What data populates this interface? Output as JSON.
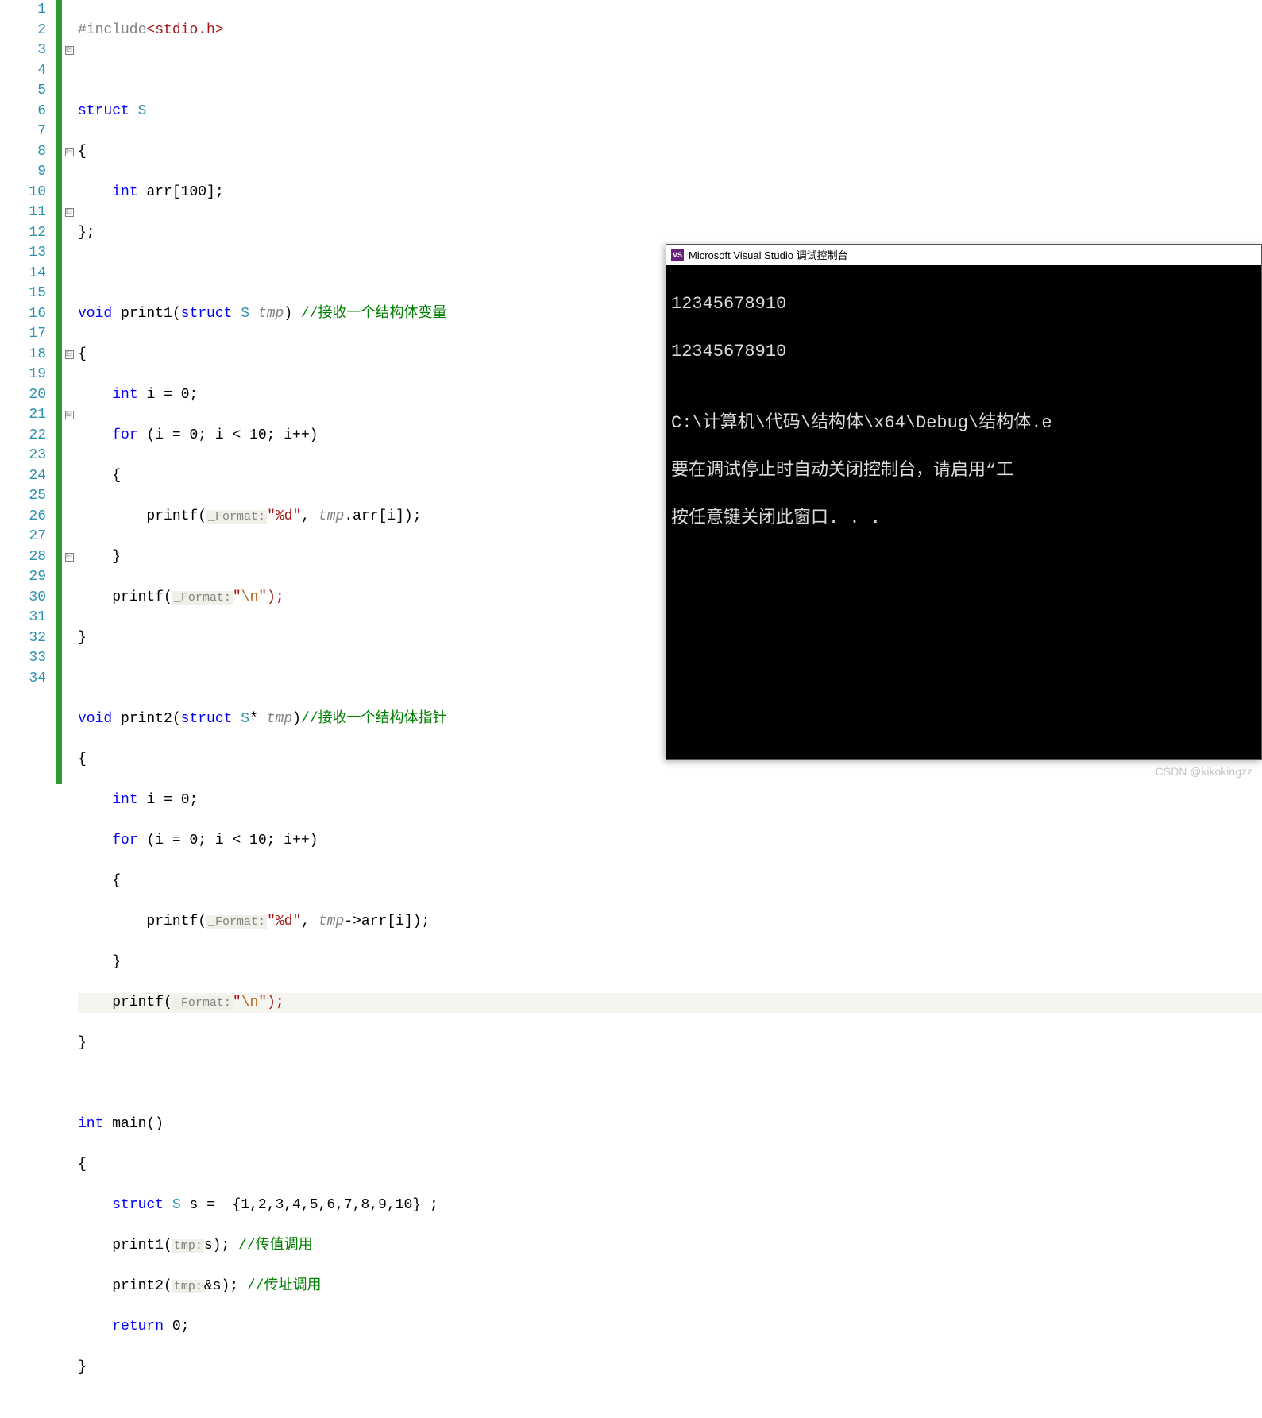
{
  "editor": {
    "line_numbers": [
      "1",
      "2",
      "3",
      "4",
      "5",
      "6",
      "7",
      "8",
      "9",
      "10",
      "11",
      "12",
      "13",
      "14",
      "15",
      "16",
      "17",
      "18",
      "19",
      "20",
      "21",
      "22",
      "23",
      "24",
      "25",
      "26",
      "27",
      "28",
      "29",
      "30",
      "31",
      "32",
      "33",
      "34"
    ],
    "fold_markers": {
      "3": "⊟",
      "8": "⊟",
      "11": "⊟",
      "18": "⊟",
      "21": "⊟",
      "28": "⊟"
    },
    "tokens": {
      "include_directive": "#include",
      "include_header_open": "<",
      "include_header": "stdio.h",
      "include_header_close": ">",
      "kw_struct": "struct",
      "struct_name": "S",
      "brace_open": "{",
      "brace_close_semi": "};",
      "kw_int": "int",
      "field_arr": "arr",
      "arr_size": "[100];",
      "kw_void": "void",
      "fn_print1": "print1",
      "fn_print2": "print2",
      "fn_main": "main",
      "paren_open": "(",
      "paren_close": ")",
      "param_struct": "struct",
      "param_S": "S",
      "param_tmp": "tmp",
      "star": "*",
      "comment_print1": "//接收一个结构体变量",
      "comment_print2": "//接收一个结构体指针",
      "brace_open_plain": "{",
      "brace_close_plain": "}",
      "decl_i": "i",
      "eq": "=",
      "zero": "0",
      "semi": ";",
      "kw_for": "for",
      "for_cond_open": "(i = 0; i < 10; i++)",
      "fn_printf": "printf",
      "hint_format": "_Format:",
      "str_pct_d": "\"%d\"",
      "comma": ",",
      "tmp_dot_arr": "tmp.arr[i]);",
      "tmp_arrow_arr": "tmp->arr[i]);",
      "str_nl_open": "\"",
      "str_nl_esc": "\\n",
      "str_nl_close": "\");",
      "var_s": "s",
      "initlist": "{1,2,3,4,5,6,7,8,9,10}",
      "hint_tmp": "tmp:",
      "call_s": "s",
      "call_amp_s": "&s",
      "comment_byval": "//传值调用",
      "comment_byref": "//传址调用",
      "kw_return": "return",
      "ret_val": "0;"
    }
  },
  "console": {
    "title": "Microsoft Visual Studio 调试控制台",
    "icon_text": "VS",
    "lines": {
      "out1": "12345678910",
      "out2": "12345678910",
      "blank": "",
      "path": "C:\\计算机\\代码\\结构体\\x64\\Debug\\结构体.e",
      "msg1": "要在调试停止时自动关闭控制台，请启用“工",
      "msg2": "按任意键关闭此窗口. . ."
    }
  },
  "watermark": "CSDN @kikokingzz"
}
